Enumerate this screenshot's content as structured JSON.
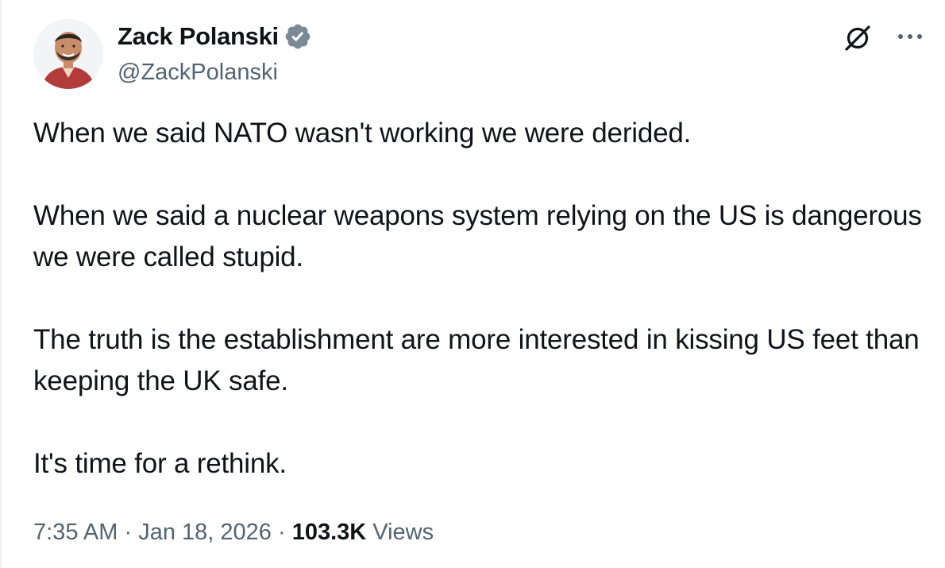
{
  "author": {
    "name": "Zack Polanski",
    "handle": "@ZackPolanski",
    "verified": true
  },
  "header_actions": {
    "grok_icon": "grok-icon",
    "more_icon": "more-options-icon"
  },
  "tweet": {
    "paragraphs": [
      "When we said NATO wasn't working we were derided.",
      "When we said a nuclear weapons system relying on the US is dangerous we were called stupid.",
      "The truth is the establishment are more interested in kissing US feet than keeping the UK safe.",
      "It's time for a rethink."
    ]
  },
  "meta": {
    "time": "7:35 AM",
    "separator": "·",
    "date": "Jan 18, 2026",
    "views_count": "103.3K",
    "views_label": "Views"
  },
  "colors": {
    "text_primary": "#0f1419",
    "text_secondary": "#536471",
    "verified_blue": "#7a8996"
  }
}
